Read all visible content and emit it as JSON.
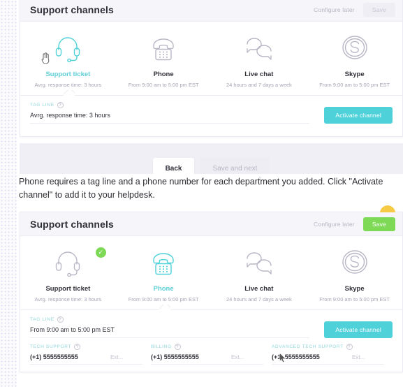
{
  "panel1": {
    "title": "Support channels",
    "configure_later": "Configure later",
    "save_label": "Save",
    "channels": [
      {
        "icon": "headset-icon",
        "name": "Support ticket",
        "sub": "Avrg. response time: 3 hours",
        "selected": true,
        "checked": false
      },
      {
        "icon": "desk-phone-icon",
        "name": "Phone",
        "sub": "From 9:00 am to 5:00 pm EST",
        "selected": false,
        "checked": false
      },
      {
        "icon": "speech-bubbles-icon",
        "name": "Live chat",
        "sub": "24 hours and 7 days a week",
        "selected": false,
        "checked": false
      },
      {
        "icon": "skype-icon",
        "name": "Skype",
        "sub": "From 9:00 am to 5:00 pm EST",
        "selected": false,
        "checked": false
      }
    ],
    "tag_line_label": "TAG LINE",
    "tag_line_value": "Avrg. response time: 3 hours",
    "activate_label": "Activate channel",
    "footer": {
      "back_label": "Back",
      "next_label": "Save and next"
    }
  },
  "instruction": "Phone requires a tag line and a phone number for each department you added. Click \"Activate channel\" to add it to your helpdesk.",
  "panel2": {
    "title": "Support channels",
    "configure_later": "Configure later",
    "save_label": "Save",
    "channels": [
      {
        "icon": "headset-icon",
        "name": "Support ticket",
        "sub": "Avrg. response time: 3 hours",
        "selected": false,
        "checked": true
      },
      {
        "icon": "desk-phone-icon",
        "name": "Phone",
        "sub": "From 9:00 am to 5:00 pm EST",
        "selected": true,
        "checked": false
      },
      {
        "icon": "speech-bubbles-icon",
        "name": "Live chat",
        "sub": "24 hours and 7 days a week",
        "selected": false,
        "checked": false
      },
      {
        "icon": "skype-icon",
        "name": "Skype",
        "sub": "From 9:00 am to 5:00 pm EST",
        "selected": false,
        "checked": false
      }
    ],
    "tag_line_label": "TAG LINE",
    "tag_line_value": "From 9:00 am to 5:00 pm EST",
    "activate_label": "Activate channel",
    "departments": [
      {
        "label": "TECH SUPPORT",
        "phone": "(+1) 5555555555",
        "ext_placeholder": "Ext..."
      },
      {
        "label": "BILLING",
        "phone": "(+1) 5555555555",
        "ext_placeholder": "Ext..."
      },
      {
        "label": "ADVANCED TECH SUPPORT",
        "phone": "(+1) 5555555555",
        "ext_placeholder": "Ext..."
      }
    ]
  },
  "colors": {
    "accent_teal": "#4fd1d9",
    "accent_green": "#7ed957",
    "badge_yellow": "#f7ca45",
    "header_bg": "#f6f5fa",
    "text_dark": "#2f2f38",
    "text_muted": "#a6a4b5"
  },
  "help_glyph": "?",
  "check_glyph": "✓"
}
